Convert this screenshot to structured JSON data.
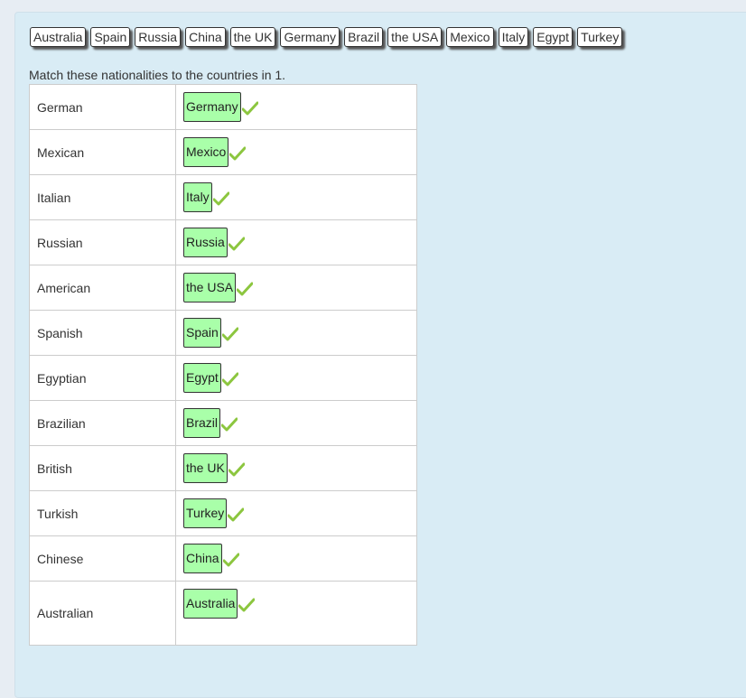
{
  "word_bank": [
    "Australia",
    "Spain",
    "Russia",
    "China",
    "the UK",
    "Germany",
    "Brazil",
    "the USA",
    "Mexico",
    "Italy",
    "Egypt",
    "Turkey"
  ],
  "instruction": "Match these nationalities to the countries in 1.",
  "rows": [
    {
      "nationality": "German",
      "answer": "Germany",
      "correct": true
    },
    {
      "nationality": "Mexican",
      "answer": "Mexico",
      "correct": true
    },
    {
      "nationality": "Italian",
      "answer": "Italy",
      "correct": true
    },
    {
      "nationality": "Russian",
      "answer": "Russia",
      "correct": true
    },
    {
      "nationality": "American",
      "answer": "the USA",
      "correct": true
    },
    {
      "nationality": "Spanish",
      "answer": "Spain",
      "correct": true
    },
    {
      "nationality": "Egyptian",
      "answer": "Egypt",
      "correct": true
    },
    {
      "nationality": "Brazilian",
      "answer": "Brazil",
      "correct": true
    },
    {
      "nationality": "British",
      "answer": "the UK",
      "correct": true
    },
    {
      "nationality": "Turkish",
      "answer": "Turkey",
      "correct": true
    },
    {
      "nationality": "Chinese",
      "answer": "China",
      "correct": true
    },
    {
      "nationality": "Australian",
      "answer": "Australia",
      "correct": true
    }
  ],
  "colors": {
    "answer_bg": "#a9ffa9",
    "check": "#8cc63f",
    "panel_bg": "#d9ecf5"
  },
  "icons": {
    "correct": "check-icon"
  }
}
